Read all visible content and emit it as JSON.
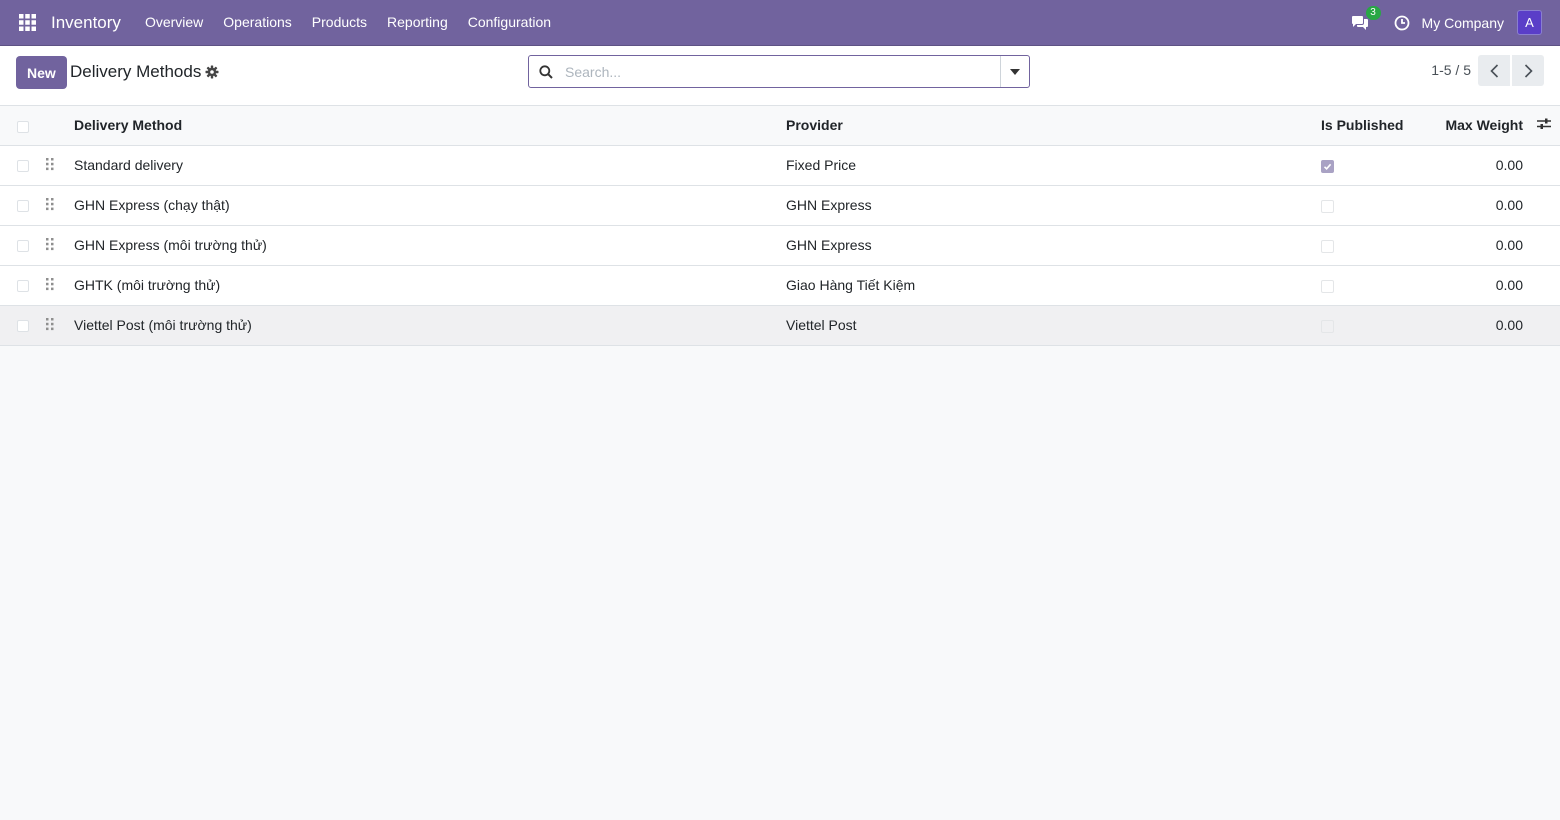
{
  "navbar": {
    "brand": "Inventory",
    "menu": [
      "Overview",
      "Operations",
      "Products",
      "Reporting",
      "Configuration"
    ],
    "chat_badge": "3",
    "company": "My Company",
    "avatar_letter": "A",
    "bg_color": "#71639e"
  },
  "control": {
    "new_label": "New",
    "title": "Delivery Methods",
    "search_placeholder": "Search...",
    "pager": "1-5 / 5"
  },
  "table": {
    "headers": {
      "method": "Delivery Method",
      "provider": "Provider",
      "published": "Is Published",
      "max_weight": "Max Weight"
    },
    "rows": [
      {
        "method": "Standard delivery",
        "provider": "Fixed Price",
        "published": true,
        "max_weight": "0.00"
      },
      {
        "method": "GHN Express (chạy thật)",
        "provider": "GHN Express",
        "published": false,
        "max_weight": "0.00"
      },
      {
        "method": "GHN Express (môi trường thử)",
        "provider": "GHN Express",
        "published": false,
        "max_weight": "0.00"
      },
      {
        "method": "GHTK (môi trường thử)",
        "provider": "Giao Hàng Tiết Kiệm",
        "published": false,
        "max_weight": "0.00"
      },
      {
        "method": "Viettel Post (môi trường thử)",
        "provider": "Viettel Post",
        "published": false,
        "max_weight": "0.00"
      }
    ]
  }
}
